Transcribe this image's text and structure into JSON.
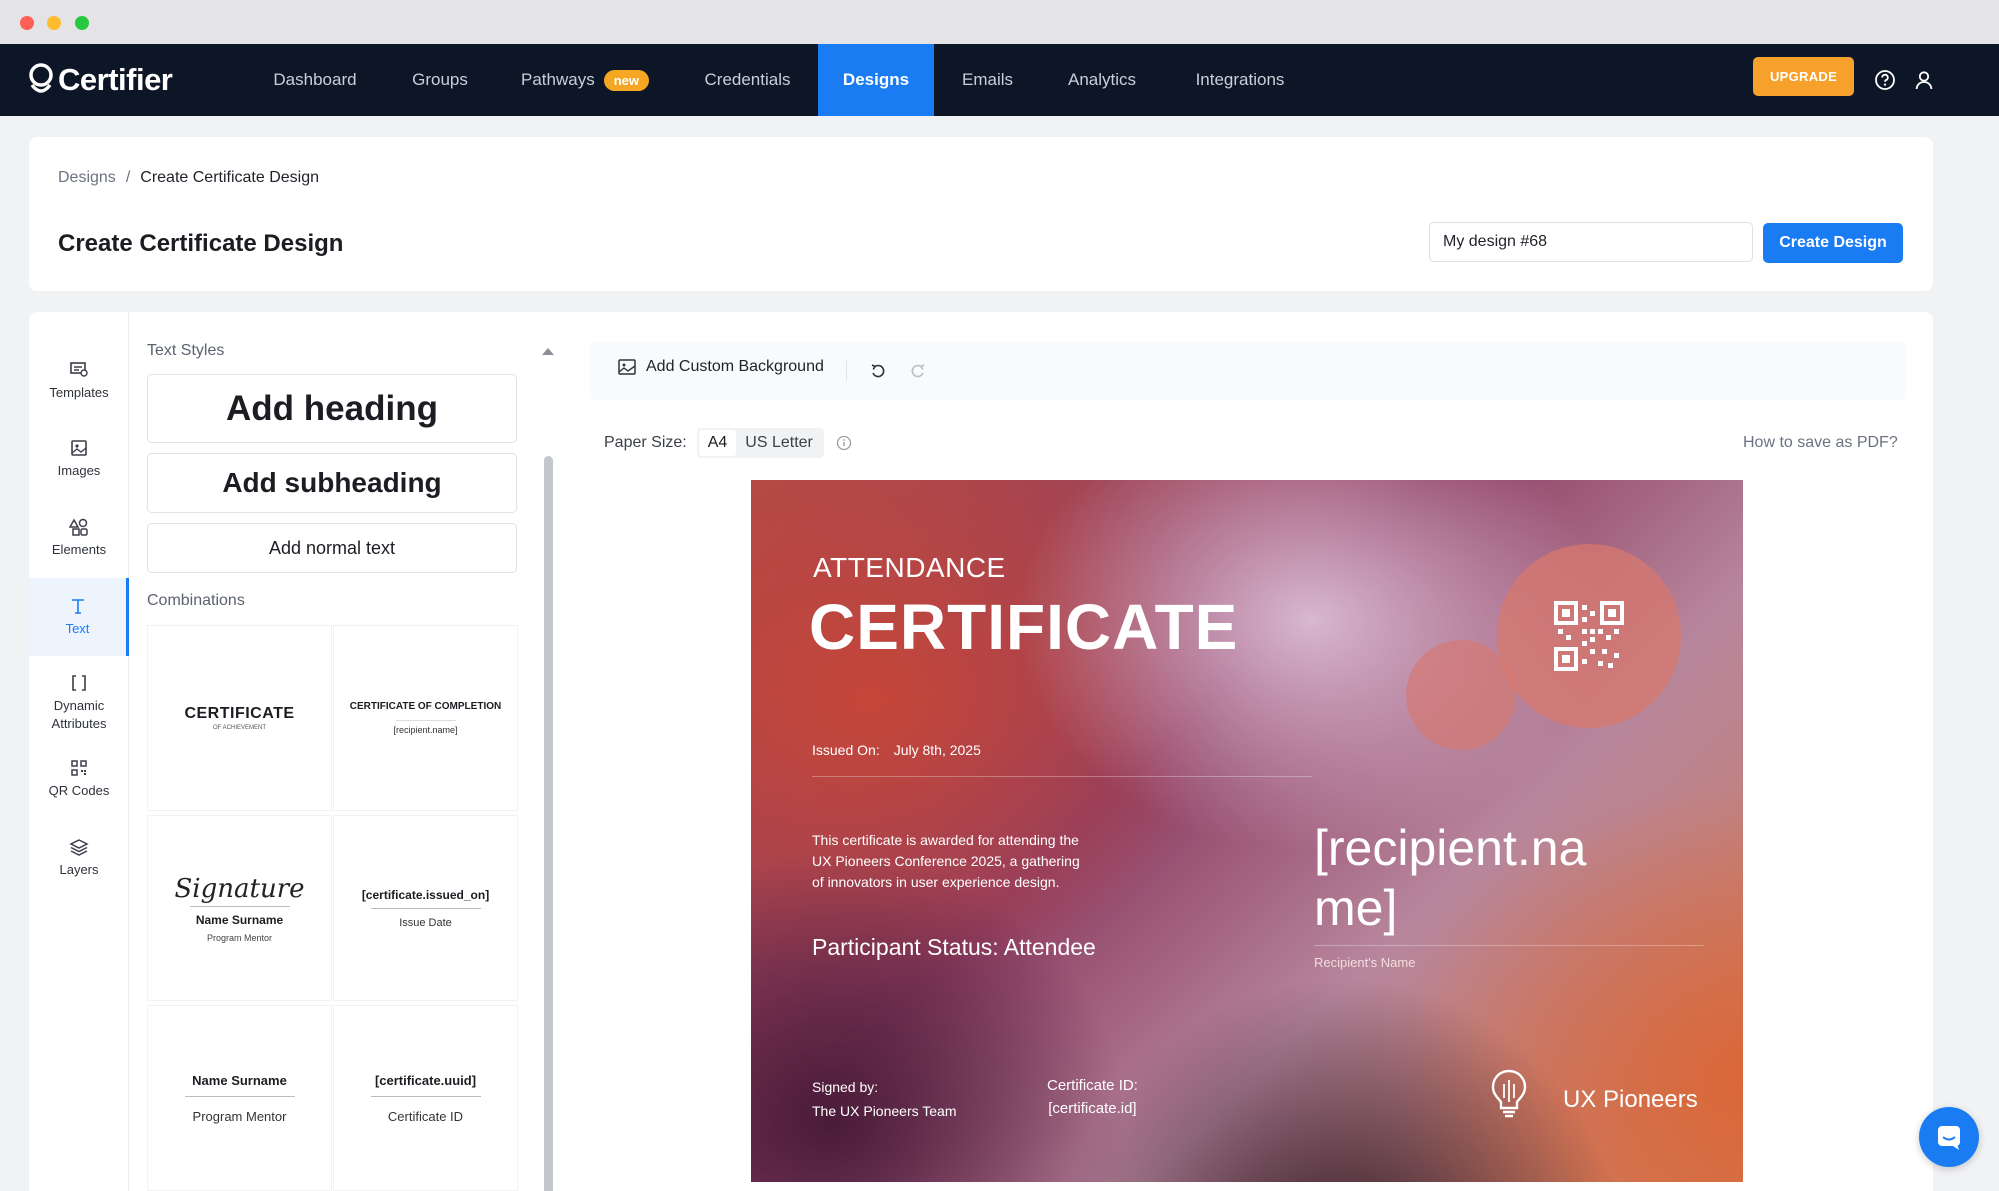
{
  "app": {
    "name": "Certifier"
  },
  "nav": {
    "items": [
      {
        "label": "Dashboard"
      },
      {
        "label": "Groups"
      },
      {
        "label": "Pathways",
        "badge": "new"
      },
      {
        "label": "Credentials"
      },
      {
        "label": "Designs",
        "active": true
      },
      {
        "label": "Emails"
      },
      {
        "label": "Analytics"
      },
      {
        "label": "Integrations"
      }
    ],
    "upgrade_label": "UPGRADE",
    "help_icon": "help-circle-icon",
    "user_icon": "user-icon",
    "accent_color": "#1a7cf3",
    "upgrade_color": "#f5a12c"
  },
  "breadcrumb": {
    "root": "Designs",
    "separator": "/",
    "current": "Create Certificate Design"
  },
  "page": {
    "title": "Create Certificate Design",
    "design_name_value": "My design #68",
    "create_button": "Create Design"
  },
  "sidebar": {
    "tabs": [
      {
        "label": "Templates",
        "icon": "templates-icon"
      },
      {
        "label": "Images",
        "icon": "image-icon"
      },
      {
        "label": "Elements",
        "icon": "shapes-icon"
      },
      {
        "label": "Text",
        "icon": "text-icon",
        "active": true
      },
      {
        "label": "Dynamic\nAttributes",
        "icon": "brackets-icon"
      },
      {
        "label": "QR Codes",
        "icon": "qr-code-icon"
      },
      {
        "label": "Layers",
        "icon": "layers-icon"
      }
    ]
  },
  "panel": {
    "text_styles_label": "Text Styles",
    "heading": "Add heading",
    "subheading": "Add subheading",
    "normal": "Add normal text",
    "combinations_label": "Combinations",
    "combos": {
      "c1": {
        "title": "CERTIFICATE",
        "sub": "OF ACHIEVEMENT"
      },
      "c2": {
        "title": "CERTIFICATE OF COMPLETION",
        "sub": "[recipient.name]"
      },
      "c3": {
        "script": "Signature",
        "name": "Name Surname",
        "role": "Program Mentor"
      },
      "c4": {
        "value": "[certificate.issued_on]",
        "label": "Issue Date"
      },
      "c5": {
        "name": "Name Surname",
        "role": "Program Mentor"
      },
      "c6": {
        "value": "[certificate.uuid]",
        "label": "Certificate ID"
      }
    }
  },
  "toolbar": {
    "add_background": "Add Custom Background",
    "undo_icon": "undo-icon",
    "redo_icon": "redo-icon"
  },
  "paper": {
    "label": "Paper Size:",
    "options": [
      "A4",
      "US Letter"
    ],
    "selected": "A4",
    "help": "How to save as PDF?"
  },
  "certificate": {
    "kicker": "ATTENDANCE",
    "title": "CERTIFICATE",
    "issued_label": "Issued On:",
    "issued_value": "July 8th, 2025",
    "description_1": "This certificate is awarded for attending the",
    "description_2": "UX Pioneers Conference 2025, a gathering",
    "description_3": "of innovators in user experience design.",
    "status": "Participant Status: Attendee",
    "recipient_1": "[recipient.na",
    "recipient_2": "me]",
    "recipient_caption": "Recipient's Name",
    "signed_label": "Signed by:",
    "signed_value": "The UX Pioneers Team",
    "id_label": "Certificate ID:",
    "id_value": "[certificate.id]",
    "org_name": "UX Pioneers",
    "org_icon": "lightbulb-icon"
  },
  "chat_icon": "chat-icon"
}
